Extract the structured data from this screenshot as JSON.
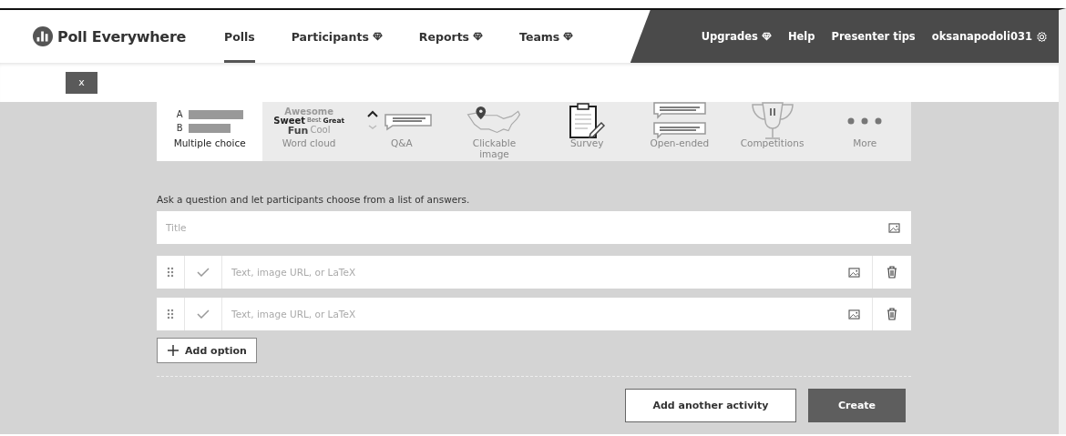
{
  "header": {
    "brand": "Poll Everywhere",
    "nav": [
      {
        "label": "Polls",
        "selected": true,
        "premium": false
      },
      {
        "label": "Participants",
        "selected": false,
        "premium": true
      },
      {
        "label": "Reports",
        "selected": false,
        "premium": true
      },
      {
        "label": "Teams",
        "selected": false,
        "premium": true
      }
    ],
    "right_nav": [
      {
        "label": "Upgrades",
        "premium": true,
        "kind": "link"
      },
      {
        "label": "Help",
        "premium": false,
        "kind": "link"
      },
      {
        "label": "Presenter tips",
        "premium": false,
        "kind": "link"
      },
      {
        "label": "oksanapodoli031",
        "premium": false,
        "kind": "user"
      }
    ]
  },
  "close_button": "x",
  "activity_types": [
    {
      "label": "Multiple choice",
      "selected": true,
      "kind": "multiple-choice",
      "icon_text": [
        "A",
        "B"
      ]
    },
    {
      "label": "Word cloud",
      "selected": false,
      "kind": "word-cloud",
      "icon_text": [
        "Awesome",
        "Sweet",
        "Best",
        "Great",
        "Fun",
        "Cool"
      ]
    },
    {
      "label": "Q&A",
      "selected": false,
      "kind": "qa"
    },
    {
      "label": "Clickable image",
      "selected": false,
      "kind": "map"
    },
    {
      "label": "Survey",
      "selected": false,
      "kind": "survey"
    },
    {
      "label": "Open-ended",
      "selected": false,
      "kind": "open-ended"
    },
    {
      "label": "Competitions",
      "selected": false,
      "kind": "trophy"
    },
    {
      "label": "More",
      "selected": false,
      "kind": "more"
    }
  ],
  "description": "Ask a question and let participants choose from a list of answers.",
  "title_field": {
    "placeholder": "Title"
  },
  "options": [
    {
      "placeholder": "Text, image URL, or LaTeX"
    },
    {
      "placeholder": "Text, image URL, or LaTeX"
    }
  ],
  "add_option": "Add option",
  "buttons": [
    {
      "label": "Add another activity",
      "kind": "secondary"
    },
    {
      "label": "Create",
      "kind": "primary"
    }
  ]
}
